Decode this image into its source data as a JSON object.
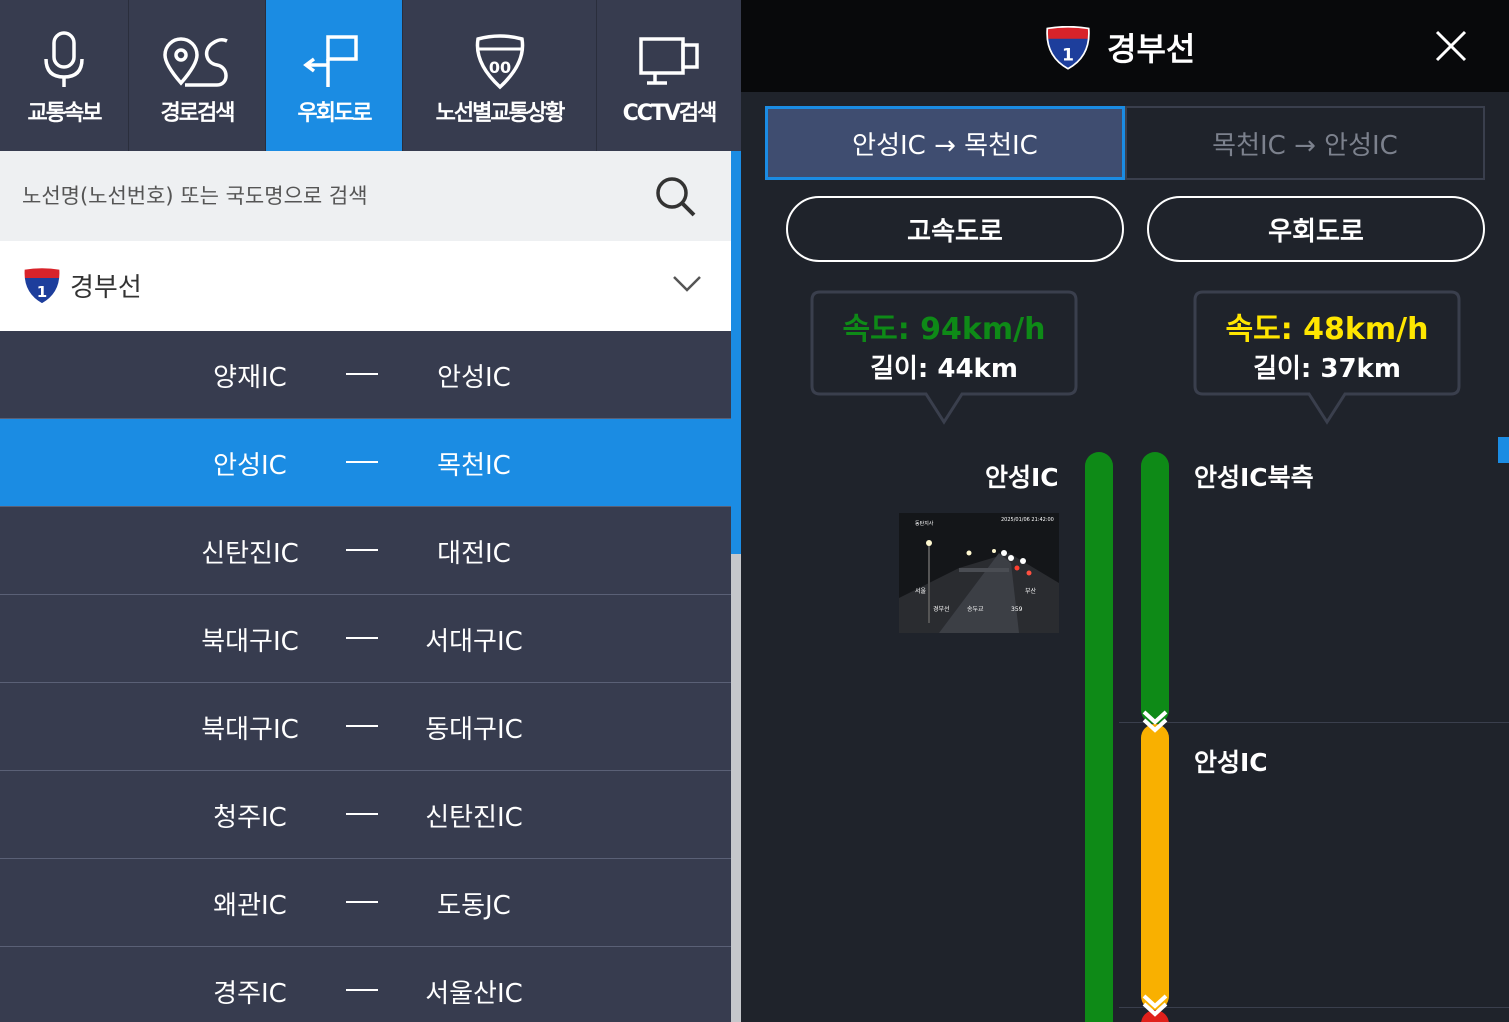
{
  "nav": {
    "items": [
      {
        "label": "교통속보",
        "icon": "microphone-icon"
      },
      {
        "label": "경로검색",
        "icon": "route-pin-icon"
      },
      {
        "label": "우회도로",
        "icon": "detour-sign-icon"
      },
      {
        "label": "노선별교통상황",
        "icon": "highway-shield-icon"
      },
      {
        "label": "CCTV검색",
        "icon": "monitor-icon"
      }
    ],
    "active_index": 2
  },
  "search": {
    "placeholder": "노선명(노선번호) 또는 국도명으로 검색",
    "icon": "search-icon"
  },
  "route": {
    "name": "경부선",
    "shield_number": "1",
    "icon": "chevron-down-icon"
  },
  "segments": [
    {
      "from": "양재IC",
      "to": "안성IC",
      "selected": false
    },
    {
      "from": "안성IC",
      "to": "목천IC",
      "selected": true
    },
    {
      "from": "신탄진IC",
      "to": "대전IC",
      "selected": false
    },
    {
      "from": "북대구IC",
      "to": "서대구IC",
      "selected": false
    },
    {
      "from": "북대구IC",
      "to": "동대구IC",
      "selected": false
    },
    {
      "from": "청주IC",
      "to": "신탄진IC",
      "selected": false
    },
    {
      "from": "왜관IC",
      "to": "도동JC",
      "selected": false
    },
    {
      "from": "경주IC",
      "to": "서울산IC",
      "selected": false
    }
  ],
  "detail": {
    "title": "경부선",
    "shield_number": "1",
    "close_icon": "close-icon",
    "direction_tabs": [
      {
        "label": "안성IC → 목천IC",
        "active": true
      },
      {
        "label": "목천IC → 안성IC",
        "active": false
      }
    ],
    "buttons": {
      "highway": "고속도로",
      "detour": "우회도로"
    },
    "highway_info": {
      "speed": "속도: 94km/h",
      "length": "길이: 44km",
      "speed_color": "#0e8a17"
    },
    "detour_info": {
      "speed": "속도: 48km/h",
      "length": "길이: 37km",
      "speed_color": "#ffe600"
    },
    "highway_label": "안성IC",
    "detour_labels": [
      "안성IC북측",
      "안성IC"
    ],
    "cctv": {
      "timestamp": "2025/01/06 21:42:00",
      "location": "동탄지사",
      "sign_left": "서울",
      "sign_right": "부산",
      "road_name": "경부선",
      "bridge": "송두교",
      "number": "359"
    },
    "colors": {
      "green": "#0e8a17",
      "orange": "#f9b000",
      "red": "#e0201b",
      "accent": "#1b8ce3"
    }
  }
}
